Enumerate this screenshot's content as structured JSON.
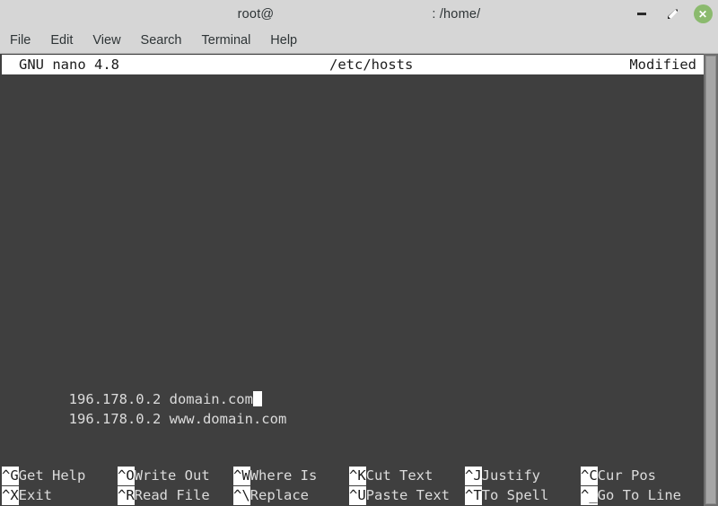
{
  "window": {
    "title_prefix": "root@",
    "title_suffix": ": /home/",
    "controls": {
      "minimize_label": "–",
      "maximize_label": "⤡",
      "close_label": "✕",
      "close_color": "#8bba6e"
    }
  },
  "menubar": {
    "items": [
      {
        "label": "File"
      },
      {
        "label": "Edit"
      },
      {
        "label": "View"
      },
      {
        "label": "Search"
      },
      {
        "label": "Terminal"
      },
      {
        "label": "Help"
      }
    ]
  },
  "nano": {
    "version": "GNU nano 4.8",
    "filename": "/etc/hosts",
    "status": "Modified",
    "buffer_lines": [
      "196.178.0.2 domain.com",
      "196.178.0.2 www.domain.com"
    ],
    "cursor": {
      "line": 1,
      "column": 23
    },
    "shortcuts_row1": [
      {
        "key": "^G",
        "label": "Get Help"
      },
      {
        "key": "^O",
        "label": "Write Out"
      },
      {
        "key": "^W",
        "label": "Where Is"
      },
      {
        "key": "^K",
        "label": "Cut Text"
      },
      {
        "key": "^J",
        "label": "Justify"
      },
      {
        "key": "^C",
        "label": "Cur Pos"
      }
    ],
    "shortcuts_row2": [
      {
        "key": "^X",
        "label": "Exit"
      },
      {
        "key": "^R",
        "label": "Read File"
      },
      {
        "key": "^\\",
        "label": "Replace"
      },
      {
        "key": "^U",
        "label": "Paste Text"
      },
      {
        "key": "^T",
        "label": "To Spell"
      },
      {
        "key": "^_",
        "label": "Go To Line"
      }
    ]
  },
  "theme": {
    "titlebar_bg": "#d6d6d6",
    "terminal_bg": "#3f3f3f",
    "terminal_fg": "#dcdcdc",
    "reverse_bg": "#ffffff",
    "reverse_fg": "#1c1c1c"
  }
}
